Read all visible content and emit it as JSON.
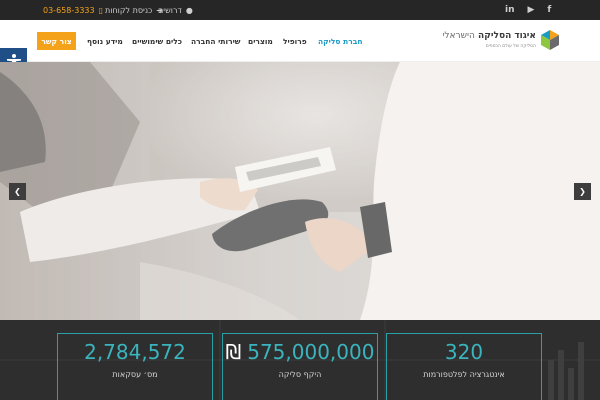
{
  "topbar": {
    "phone": "03-658-3333",
    "login": "כניסת לקוחות",
    "jobs": "דרושים",
    "social": [
      "f",
      "▶",
      "in"
    ]
  },
  "header": {
    "cta": "צור קשר",
    "nav": [
      {
        "label": "חברת סליקה",
        "active": true
      },
      {
        "label": "פרופיל",
        "active": false
      },
      {
        "label": "מוצרים",
        "active": false
      },
      {
        "label": "שירותי החברה",
        "active": false
      },
      {
        "label": "כלים שימושיים",
        "active": false
      },
      {
        "label": "מידע נוסף",
        "active": false
      }
    ],
    "logo": {
      "name_bold": "איגוד הסליקה",
      "name_light": "הישראלי",
      "tagline": "הסליקה של עולם הכספים"
    }
  },
  "stats": [
    {
      "value": "320",
      "label": "אינטגרציה לפלטפורמות"
    },
    {
      "value": "575,000,000",
      "currency": "₪",
      "label": "היקף סליקה"
    },
    {
      "value": "2,784,572",
      "label": "מס׳ עסקאות"
    }
  ],
  "colors": {
    "accent": "#1a9bc4",
    "cta": "#f3a21a",
    "stat_number": "#3ab5bd",
    "stat_border": "#2aa0a6",
    "a11y": "#1f4f86"
  },
  "icons": [
    "facebook-icon",
    "youtube-icon",
    "linkedin-icon",
    "phone-icon",
    "login-icon",
    "user-icon",
    "accessibility-icon",
    "arrow-left-icon",
    "arrow-right-icon"
  ]
}
